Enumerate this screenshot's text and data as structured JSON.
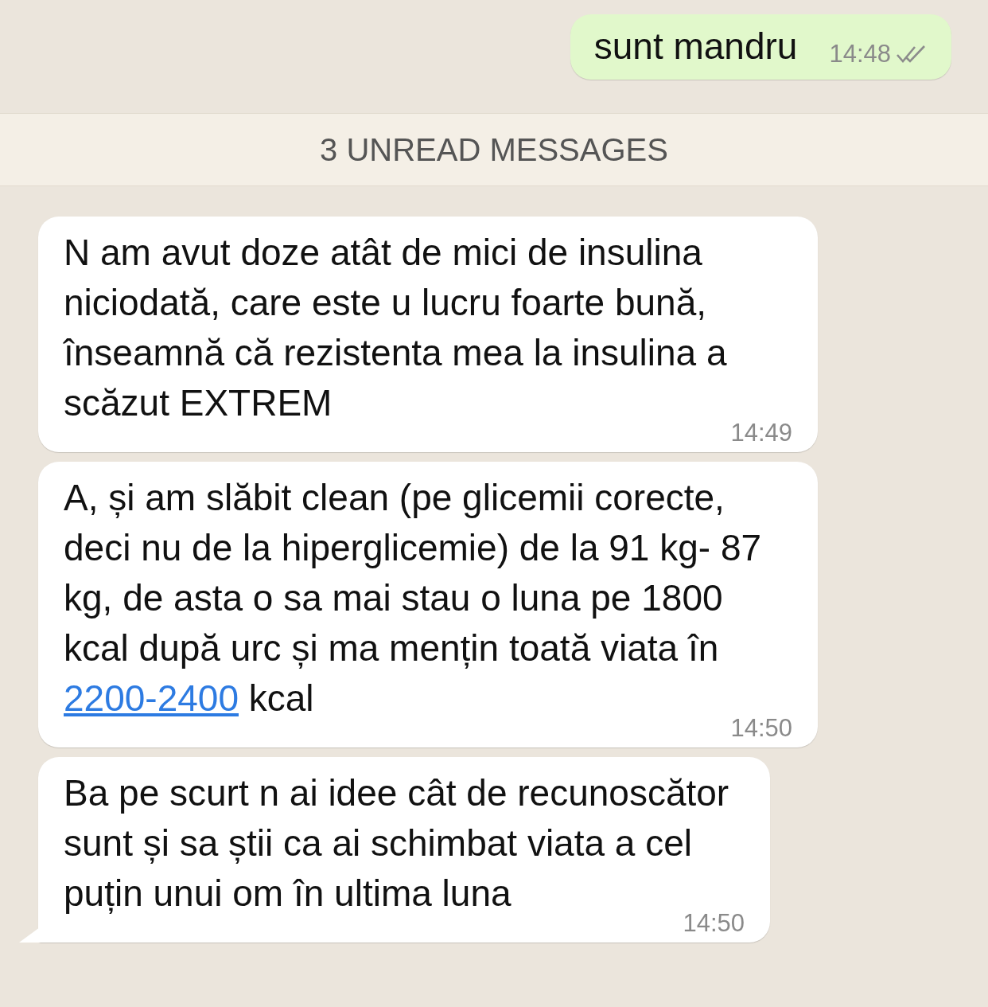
{
  "messages_before": [
    {
      "kind": "outgoing",
      "text": "sunt mandru",
      "time": "14:48",
      "read": false
    }
  ],
  "unread_banner": "3 UNREAD MESSAGES",
  "messages": [
    {
      "kind": "incoming",
      "text": "N am avut doze atât de mici de insulina niciodată, care este u  lucru foarte bună, înseamnă că rezistenta mea la insulina a scăzut EXTREM",
      "time": "14:49",
      "tail": false
    },
    {
      "kind": "incoming",
      "text": "A, și am slăbit clean (pe glicemii corecte, deci nu de la hiperglicemie) de la 91 kg- 87 kg, de asta o sa mai stau o luna pe 1800 kcal după urc și ma mențin toată viata în ",
      "link": "2200-2400",
      "text_after": " kcal",
      "time": "14:50",
      "tail": false
    },
    {
      "kind": "incoming",
      "text": "Ba pe scurt n ai idee cât de recunoscător sunt și sa știi ca ai schimbat viata a cel puțin unui om în ultima luna",
      "time": "14:50",
      "tail": true
    }
  ]
}
